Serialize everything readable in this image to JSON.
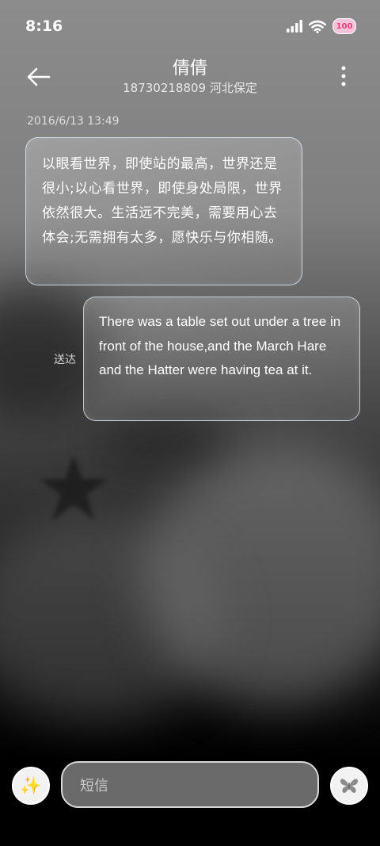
{
  "status_bar": {
    "time": "8:16",
    "battery": "100",
    "icons": [
      "signal-icon",
      "wifi-icon",
      "battery-icon"
    ]
  },
  "header": {
    "contact_name": "倩倩",
    "contact_subtitle": "18730218809 河北保定",
    "icons": [
      "back-arrow-icon",
      "more-vertical-icon"
    ]
  },
  "conversation": {
    "timestamp": "2016/6/13 13:49",
    "messages": [
      {
        "direction": "incoming",
        "text": "以眼看世界，即使站的最高，世界还是很小;以心看世界，即使身处局限，世界依然很大。生活远不完美，需要用心去体会;无需拥有太多，愿快乐与你相随。"
      },
      {
        "direction": "outgoing",
        "status": "送达",
        "text": "There was a table set out under a tree in front of the house,and the March Hare and the Hatter were having tea at it."
      }
    ]
  },
  "compose": {
    "placeholder": "短信",
    "icons": [
      "sparkle-icon",
      "butterfly-send-icon"
    ]
  },
  "colors": {
    "bubble_border": "#dfe9ff",
    "battery_fill": "#f6c3da",
    "battery_text": "#e2417b",
    "input_bg": "#6a6a6a"
  }
}
